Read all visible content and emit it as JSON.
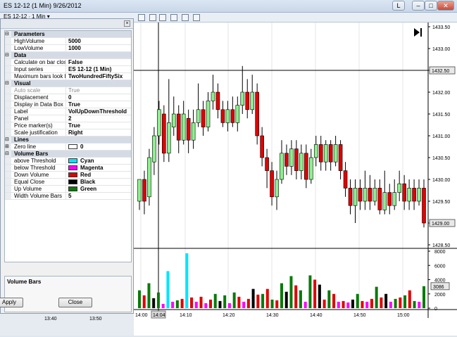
{
  "window": {
    "title": "ES 12-12 (1 Min)  9/26/2012",
    "btn_l": "L"
  },
  "toolbar": {
    "label": "ES 12-12 ∙ 1 Min ▾"
  },
  "panel": {
    "rows": [
      {
        "type": "cat",
        "key": "Parameters"
      },
      {
        "key": "HighVolume",
        "value": "5000"
      },
      {
        "key": "LowVolume",
        "value": "1000"
      },
      {
        "type": "cat",
        "key": "Data"
      },
      {
        "key": "Calculate on bar close",
        "value": "False"
      },
      {
        "key": "Input series",
        "value": "ES 12-12 (1 Min)"
      },
      {
        "key": "Maximum bars look back",
        "value": "TwoHundredFiftySix"
      },
      {
        "type": "cat",
        "key": "Visual"
      },
      {
        "key": "Auto scale",
        "value": "True",
        "disabled": true
      },
      {
        "key": "Displacement",
        "value": "0"
      },
      {
        "key": "Display in Data Box",
        "value": "True"
      },
      {
        "key": "Label",
        "value": "VolUpDownThreshold"
      },
      {
        "key": "Panel",
        "value": "2"
      },
      {
        "key": "Price marker(s)",
        "value": "True"
      },
      {
        "key": "Scale justification",
        "value": "Right"
      },
      {
        "type": "cat",
        "key": "Lines"
      },
      {
        "key": "Zero line",
        "value": "0",
        "swatch": "#ffffff",
        "expand": true
      },
      {
        "type": "cat",
        "key": "Volume Bars"
      },
      {
        "key": "above Threshold",
        "value": "Cyan",
        "swatch": "#00e5ff"
      },
      {
        "key": "below Threshold",
        "value": "Magenta",
        "swatch": "#ff00ff"
      },
      {
        "key": "Down Volume",
        "value": "Red",
        "swatch": "#e00000"
      },
      {
        "key": "Equal Close",
        "value": "Black",
        "swatch": "#000000"
      },
      {
        "key": "Up Volume",
        "value": "Green",
        "swatch": "#0a7a0a"
      },
      {
        "key": "Width Volume Bars",
        "value": "5"
      }
    ],
    "description_title": "Volume Bars",
    "apply_label": "Apply",
    "close_label": "Close"
  },
  "chart": {
    "price_ticks": [
      "1433.50",
      "1433.00",
      "1432.50",
      "1432.00",
      "1431.50",
      "1431.00",
      "1430.50",
      "1430.00",
      "1429.50",
      "1429.00",
      "1428.50"
    ],
    "price_marker_top": "1432.50",
    "price_marker_last": "1429.00",
    "volume_ticks": [
      "8000",
      "6000",
      "4000",
      "2000",
      "0"
    ],
    "volume_marker": "3086",
    "time_labels": [
      "13:40",
      "13:50",
      "14:00",
      "14:04",
      "14:10",
      "14:20",
      "14:30",
      "14:40",
      "14:50",
      "15:00"
    ],
    "colors": {
      "up": "#90ee90",
      "down": "#e00000",
      "vol_up": "#0a7a0a",
      "vol_down": "#e00000",
      "vol_low": "#ff00ff",
      "vol_high": "#00e5ff",
      "vol_equal": "#000000"
    }
  },
  "chart_data": {
    "type": "bar",
    "title": "",
    "ylim_price": [
      1428.5,
      1433.5
    ],
    "ylim_volume": [
      0,
      8000
    ],
    "candles": [
      [
        1429.5,
        1430.0,
        1429.8,
        1429.3
      ],
      [
        1430.0,
        1429.5,
        1430.2,
        1429.2
      ],
      [
        1429.6,
        1430.5,
        1430.7,
        1429.4
      ],
      [
        1430.4,
        1431.0,
        1431.2,
        1430.1
      ],
      [
        1431.0,
        1431.6,
        1431.8,
        1430.8
      ],
      [
        1431.5,
        1430.6,
        1431.7,
        1430.4
      ],
      [
        1430.6,
        1431.3,
        1432.3,
        1430.4
      ],
      [
        1431.2,
        1431.5,
        1431.9,
        1431.0
      ],
      [
        1431.5,
        1430.9,
        1431.7,
        1430.6
      ],
      [
        1430.9,
        1431.5,
        1431.8,
        1430.8
      ],
      [
        1431.4,
        1430.9,
        1431.6,
        1430.6
      ],
      [
        1430.9,
        1431.3,
        1431.6,
        1430.7
      ],
      [
        1431.3,
        1431.6,
        1432.2,
        1431.2
      ],
      [
        1431.6,
        1431.2,
        1431.8,
        1431.0
      ],
      [
        1431.2,
        1431.8,
        1432.0,
        1431.1
      ],
      [
        1431.8,
        1432.0,
        1432.4,
        1431.6
      ],
      [
        1432.0,
        1431.6,
        1432.2,
        1431.4
      ],
      [
        1431.6,
        1431.3,
        1431.8,
        1431.2
      ],
      [
        1431.3,
        1431.6,
        1431.8,
        1431.1
      ],
      [
        1431.6,
        1431.3,
        1431.9,
        1431.2
      ],
      [
        1431.3,
        1431.7,
        1431.9,
        1431.1
      ],
      [
        1431.7,
        1432.0,
        1432.6,
        1431.5
      ],
      [
        1432.0,
        1431.6,
        1432.3,
        1431.4
      ],
      [
        1431.6,
        1432.0,
        1432.4,
        1431.5
      ],
      [
        1432.0,
        1431.0,
        1432.2,
        1430.8
      ],
      [
        1431.0,
        1430.5,
        1431.2,
        1430.3
      ],
      [
        1430.5,
        1430.2,
        1430.7,
        1429.8
      ],
      [
        1430.2,
        1429.6,
        1430.4,
        1429.4
      ],
      [
        1429.6,
        1430.0,
        1430.2,
        1429.3
      ],
      [
        1430.0,
        1430.6,
        1430.9,
        1429.9
      ],
      [
        1430.6,
        1430.3,
        1430.8,
        1430.1
      ],
      [
        1430.3,
        1430.7,
        1430.9,
        1430.1
      ],
      [
        1430.7,
        1430.2,
        1430.9,
        1430.0
      ],
      [
        1430.2,
        1430.6,
        1430.8,
        1430.0
      ],
      [
        1430.6,
        1430.0,
        1430.8,
        1429.8
      ],
      [
        1430.0,
        1430.5,
        1430.7,
        1429.9
      ],
      [
        1430.5,
        1430.8,
        1431.0,
        1430.3
      ],
      [
        1430.8,
        1430.4,
        1431.0,
        1430.2
      ],
      [
        1430.4,
        1430.8,
        1430.9,
        1430.2
      ],
      [
        1430.8,
        1430.4,
        1430.9,
        1430.2
      ],
      [
        1430.4,
        1430.8,
        1431.0,
        1430.3
      ],
      [
        1430.8,
        1430.2,
        1430.9,
        1430.0
      ],
      [
        1430.2,
        1429.8,
        1430.4,
        1429.6
      ],
      [
        1429.8,
        1429.4,
        1430.0,
        1429.2
      ],
      [
        1429.4,
        1429.8,
        1430.0,
        1429.0
      ],
      [
        1429.8,
        1429.5,
        1430.0,
        1429.3
      ],
      [
        1429.5,
        1429.8,
        1430.2,
        1429.3
      ],
      [
        1429.8,
        1429.5,
        1430.1,
        1429.3
      ],
      [
        1429.5,
        1429.8,
        1430.0,
        1429.4
      ],
      [
        1429.8,
        1429.3,
        1430.0,
        1429.2
      ],
      [
        1429.3,
        1429.7,
        1430.2,
        1429.2
      ],
      [
        1429.7,
        1429.4,
        1429.9,
        1429.2
      ],
      [
        1429.4,
        1429.7,
        1430.0,
        1429.3
      ],
      [
        1429.7,
        1429.9,
        1430.2,
        1429.5
      ],
      [
        1429.9,
        1429.5,
        1430.1,
        1429.3
      ],
      [
        1429.5,
        1429.8,
        1430.0,
        1429.3
      ],
      [
        1429.8,
        1429.5,
        1430.0,
        1429.3
      ],
      [
        1429.5,
        1429.8,
        1430.0,
        1429.4
      ],
      [
        1429.8,
        1429.0,
        1430.0,
        1428.9
      ]
    ],
    "volume": [
      2500,
      1800,
      3500,
      1400,
      2200,
      600,
      5200,
      900,
      1100,
      1300,
      7700,
      1500,
      900,
      1600,
      700,
      1200,
      2000,
      1000,
      1800,
      700,
      2200,
      1600,
      900,
      1300,
      2700,
      1900,
      2000,
      2700,
      1200,
      1100,
      3500,
      2300,
      4500,
      3200,
      2500,
      900,
      4600,
      4000,
      3300,
      1200,
      2500,
      2000,
      900,
      1000,
      800,
      1200,
      2000,
      1000,
      900,
      1300,
      3000,
      1500,
      2000,
      900,
      1300,
      1500,
      1800,
      2500,
      1000,
      900,
      3086
    ]
  }
}
